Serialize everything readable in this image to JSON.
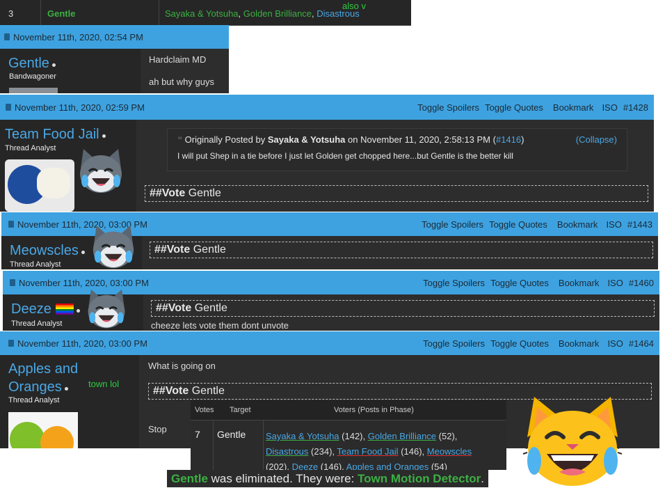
{
  "top_row": {
    "num": "3",
    "name": "Gentle",
    "voters": [
      "Sayaka & Yotsuha",
      "Golden Brilliance",
      "Disastrous"
    ],
    "also": "also v"
  },
  "colors": {
    "bar": "#3ea2e0",
    "link_blue": "#4aa8e6",
    "green": "#3cb043",
    "panel": "#2d2d2d"
  },
  "posts": [
    {
      "date": "November 11th, 2020, 02:54 PM",
      "user": "Gentle",
      "title": "Bandwagoner",
      "lines": [
        "Hardclaim MD",
        "ah but why guys"
      ]
    },
    {
      "date": "November 11th, 2020, 02:59 PM",
      "user": "Team Food Jail",
      "title": "Thread Analyst",
      "actions": [
        "Toggle Spoilers",
        "Toggle Quotes",
        "Bookmark",
        "ISO",
        "#1428"
      ],
      "quote": {
        "prefix": "Originally Posted by",
        "author": "Sayaka & Yotsuha",
        "on": "on November 11, 2020, 2:58:13 PM (",
        "ref": "#1416",
        "close": ")",
        "collapse": "(Collapse)",
        "text": "I will put Shep in a tie before I just let Golden get chopped here...but Gentle is the better kill"
      },
      "vote_tag": "##Vote",
      "vote_target": "Gentle"
    },
    {
      "date": "November 11th, 2020, 03:00 PM",
      "user": "Meowscles",
      "title": "Thread Analyst",
      "actions": [
        "Toggle Spoilers",
        "Toggle Quotes",
        "Bookmark",
        "ISO",
        "#1443"
      ],
      "vote_tag": "##Vote",
      "vote_target": "Gentle"
    },
    {
      "date": "November 11th, 2020, 03:00 PM",
      "user": "Deeze",
      "title": "Thread Analyst",
      "actions": [
        "Toggle Spoilers",
        "Toggle Quotes",
        "Bookmark",
        "ISO",
        "#1460"
      ],
      "vote_tag": "##Vote",
      "vote_target": "Gentle",
      "extra": "cheeze lets vote them dont unvote"
    },
    {
      "date": "November 11th, 2020, 03:00 PM",
      "user": "Apples and Oranges",
      "title": "Thread Analyst",
      "side": "town lol",
      "actions": [
        "Toggle Spoilers",
        "Toggle Quotes",
        "Bookmark",
        "ISO",
        "#1464"
      ],
      "line1": "What is going on",
      "vote_tag": "##Vote",
      "vote_target": "Gentle",
      "line2": "Stop"
    }
  ],
  "vote_table": {
    "headers": [
      "Votes",
      "Target",
      "Voters (Posts in Phase)"
    ],
    "row": {
      "votes": "7",
      "target": "Gentle",
      "voters": [
        {
          "name": "Sayaka & Yotsuha",
          "count": "(142)",
          "u": "green"
        },
        {
          "name": "Golden Brilliance",
          "count": "(52)",
          "u": "green"
        },
        {
          "name": "Disastrous",
          "count": "(234)",
          "u": "green"
        },
        {
          "name": "Team Food Jail",
          "count": "(146)",
          "u": "red"
        },
        {
          "name": "Meowscles",
          "count": "(202)",
          "u": "red"
        },
        {
          "name": "Deeze",
          "count": "(146)",
          "u": "red"
        },
        {
          "name": "Apples and Oranges",
          "count": "(54)",
          "u": "green"
        }
      ]
    }
  },
  "elimination": {
    "name": "Gentle",
    "mid": "was eliminated. They were:",
    "role": "Town Motion Detector",
    "end": "."
  }
}
